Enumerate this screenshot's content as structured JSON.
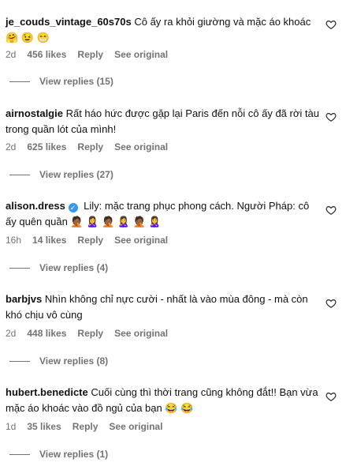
{
  "comments": [
    {
      "username": "je_couds_vintage_60s70s",
      "text": "Cô ấy ra khỏi giường và mặc áo khoác",
      "emoji": "🤗 😉 😁",
      "age": "2d",
      "likes": "456 likes",
      "reply": "Reply",
      "see_original": "See original",
      "view_replies": "View replies (15)"
    },
    {
      "username": "airnostalgie",
      "text": "Rất háo hức được gặp lại Paris đến nỗi cô ấy đã rời tàu trong quần lót của mình!",
      "emoji": "",
      "age": "2d",
      "likes": "625 likes",
      "reply": "Reply",
      "see_original": "See original",
      "view_replies": "View replies (27)"
    },
    {
      "username": "alison.dress",
      "verified": true,
      "text": "Lily: mặc trang phục phong cách. Người Pháp: cô ấy quên quần",
      "emoji": "🤦🏾 🙎‍♀️ 🤦🏾 🙎‍♀️ 🤦🏾 🙎‍♀️",
      "age": "16h",
      "likes": "14 likes",
      "reply": "Reply",
      "see_original": "See original",
      "view_replies": "View replies (4)"
    },
    {
      "username": "barbjvs",
      "text": "Nhìn không chỉ nực cười - nhất là vào mùa đông - mà còn khó chịu vô cùng",
      "emoji": "",
      "age": "2d",
      "likes": "448 likes",
      "reply": "Reply",
      "see_original": "See original",
      "view_replies": "View replies (8)"
    },
    {
      "username": "hubert.benedicte",
      "text": "Cuối cùng thì thời trang cũng không đắt!! Bạn vừa mặc áo khoác vào đồ ngủ của bạn",
      "emoji": "😂 😂",
      "age": "1d",
      "likes": "35 likes",
      "reply": "Reply",
      "see_original": "See original",
      "view_replies": "View replies (1)"
    }
  ]
}
